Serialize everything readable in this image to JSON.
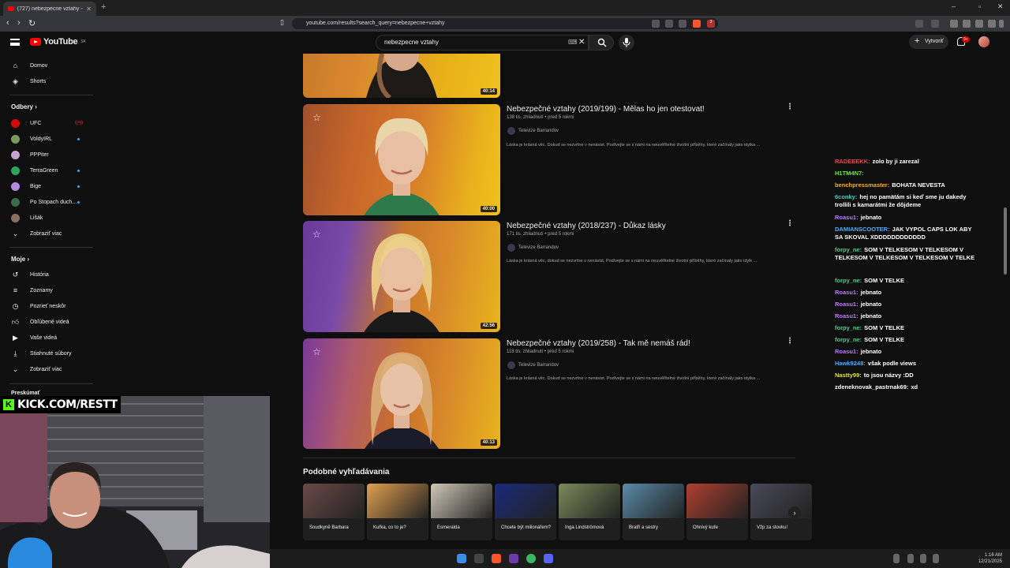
{
  "browser": {
    "tab_title": "(727) nebezpecne vztahy - YouTube",
    "url": "youtube.com/results?search_query=nebezpecne+vztahy",
    "ext_badge": "3"
  },
  "header": {
    "logo_text": "YouTube",
    "logo_country": "SK",
    "search_value": "nebezpecne vztahy",
    "create_label": "Vytvoriť",
    "notif_badge": "9+"
  },
  "sidebar": {
    "main": [
      {
        "label": "Domov",
        "icon": "home-icon"
      },
      {
        "label": "Shorts",
        "icon": "shorts-icon"
      }
    ],
    "subs_title": "Odbery",
    "subs": [
      {
        "label": "UFC",
        "color": "#d20a0a",
        "live": true
      },
      {
        "label": "VoldyIRL",
        "color": "#7a9a5a",
        "dot": true
      },
      {
        "label": "PPPiter",
        "color": "#c6a0d0",
        "dot": false
      },
      {
        "label": "TerraGreen",
        "color": "#2fa35a",
        "dot": true
      },
      {
        "label": "Bige",
        "color": "#b48ae0",
        "dot": true
      },
      {
        "label": "Po Stopach duch...",
        "color": "#3c6a4a",
        "dot": true
      },
      {
        "label": "Lišák",
        "color": "#8a7060",
        "dot": false
      }
    ],
    "show_more": "Zobraziť viac",
    "you_title": "Moje",
    "you": [
      {
        "label": "História",
        "icon": "history-icon"
      },
      {
        "label": "Zoznamy",
        "icon": "playlists-icon"
      },
      {
        "label": "Pozrieť neskôr",
        "icon": "watch-later-icon"
      },
      {
        "label": "Obľúbené videá",
        "icon": "liked-icon"
      },
      {
        "label": "Vaše videá",
        "icon": "your-videos-icon"
      },
      {
        "label": "Stiahnuté súbory",
        "icon": "download-icon"
      },
      {
        "label": "Zobraziť viac",
        "icon": "chevron-down-icon"
      }
    ],
    "explore_title": "Preskúmať"
  },
  "results": [
    {
      "duration": "40:14"
    },
    {
      "title": "Nebezpečné vztahy (2019/199) - Mělas ho jen otestovat!",
      "meta": "138 tis. zhliadnutí • pred 5 rokmi",
      "channel": "Televize Barrandov",
      "desc": "Láska je krásná věc. Dokud se nezvrtne v nenávist. Podívejte se s námi na neuvěřitelné životní příběhy, které začínaly jako idylka ...",
      "duration": "40:00"
    },
    {
      "title": "Nebezpečné vztahy (2018/237) - Důkaz lásky",
      "meta": "171 tis. zhliadnutí • pred 5 rokmi",
      "channel": "Televize Barrandov",
      "desc": "Láska je krásná věc, dokud se nezvrtne v nenávist. Podívejte se s námi na neuvěřitelné životní příběhy, které začínaly jako idylk ...",
      "duration": "42:56"
    },
    {
      "title": "Nebezpečné vztahy (2019/258) - Tak mě nemáš rád!",
      "meta": "118 tis. zhliadnutí • pred 5 rokmi",
      "channel": "Televize Barrandov",
      "desc": "Láska je krásná věc. Dokud se nezvrtne v nenávist. Podívejte se s námi na neuvěřitelné životní příběhy, které začínaly jako idylka ...",
      "duration": "40:13"
    }
  ],
  "related": {
    "title": "Podobné vyhľadávania",
    "items": [
      {
        "label": "Soudkyně Barbara",
        "color": "#6a4a48"
      },
      {
        "label": "Kuřka, co to je?",
        "color": "#e0a050"
      },
      {
        "label": "Esmeralda",
        "color": "#d0c8b8"
      },
      {
        "label": "Chcete být milionářem?",
        "color": "#1a2a7a"
      },
      {
        "label": "Inga Lindströmová",
        "color": "#7a8a5a"
      },
      {
        "label": "Bratři a sestry",
        "color": "#5a8aa8"
      },
      {
        "label": "Ohnivý kuře",
        "color": "#b04030"
      },
      {
        "label": "Vžp za stovku!",
        "color": "#4a4a5a"
      }
    ]
  },
  "chat": [
    {
      "user": "RADEEEKK:",
      "text": "zolo by ji zarezal",
      "color": "#ff4040"
    },
    {
      "user": "H1TM4N7:",
      "text": "",
      "color": "#53fc18"
    },
    {
      "user": "benchpressmaster:",
      "text": "BOHATA NEVESTA",
      "color": "#ffb000"
    },
    {
      "user": "6conky:",
      "text": "hej no pamätám si keď sme ju dakedy trollili s kamarátmi že dôjdeme",
      "color": "#4ad0c0"
    },
    {
      "user": "Roasu1:",
      "text": "jebnato",
      "color": "#c07aff"
    },
    {
      "user": "DAMIANSCOOTER:",
      "text": "JAK VYPOL CAPS LOK ABY SA SKOVAL XDDDDDDDDDDDD",
      "color": "#4ab0ff"
    },
    {
      "user": "forpy_ne:",
      "text": "SOM V TELKESOM V TELKESOM V TELKESOM V TELKESOM V TELKESOM V TELKE",
      "color": "#4ad08a"
    },
    {
      "user": "forpy_ne:",
      "text": "SOM V TELKE",
      "color": "#4ad08a"
    },
    {
      "user": "Roasu1:",
      "text": "jebnato",
      "color": "#c07aff"
    },
    {
      "user": "Roasu1:",
      "text": "jebnato",
      "color": "#c07aff"
    },
    {
      "user": "Roasu1:",
      "text": "jebnato",
      "color": "#c07aff"
    },
    {
      "user": "forpy_ne:",
      "text": "SOM V TELKE",
      "color": "#4ad08a"
    },
    {
      "user": "forpy_ne:",
      "text": "SOM V TELKE",
      "color": "#4ad08a"
    },
    {
      "user": "Roasu1:",
      "text": "jebnato",
      "color": "#c07aff"
    },
    {
      "user": "Hawk9248:",
      "text": "však podle views",
      "color": "#4ab0ff"
    },
    {
      "user": "Nastty99:",
      "text": "to jsou názvy :DD",
      "color": "#e0e040"
    },
    {
      "user": "zdeneknovak_pastrnak69:",
      "text": "xd",
      "color": "#ffffff"
    }
  ],
  "overlay": {
    "kick_text": "KICK.COM/RESTT"
  },
  "taskbar": {
    "time": "1:16 AM",
    "date": "12/21/2025"
  }
}
